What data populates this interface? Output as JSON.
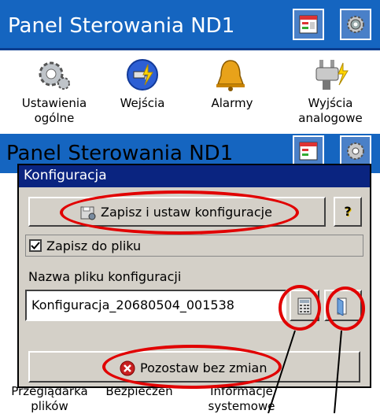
{
  "top_panel": {
    "title": "Panel Sterowania ND1",
    "apps": [
      {
        "icon": "gears-icon",
        "label_line1": "Ustawienia",
        "label_line2": "ogólne"
      },
      {
        "icon": "input-plug-icon",
        "label_line1": "Wejścia",
        "label_line2": ""
      },
      {
        "icon": "bell-icon",
        "label_line1": "Alarmy",
        "label_line2": ""
      },
      {
        "icon": "analog-output-icon",
        "label_line1": "Wyjścia",
        "label_line2": "analogowe"
      }
    ]
  },
  "back_panel": {
    "title": "Panel Sterowania ND1",
    "bottom_labels": [
      {
        "line1": "Przeglądarka",
        "line2": "plików"
      },
      {
        "line1": "Bezpieczeń",
        "line2": ""
      },
      {
        "line1": "Informacje",
        "line2": "systemowe"
      }
    ]
  },
  "dialog": {
    "title": "Konfiguracja",
    "save_button_label": "Zapisz i ustaw konfiguracje",
    "help_button_label": "?",
    "save_to_file_label": "Zapisz do pliku",
    "save_to_file_checked": true,
    "filename_label": "Nazwa pliku konfiguracji",
    "filename_value": "Konfiguracja_20680504_001538",
    "cancel_button_label": "Pozostaw bez zmian"
  },
  "colors": {
    "title_bar": "#1565c0",
    "dialog_title": "#0a2480",
    "annotation": "#e10000"
  }
}
